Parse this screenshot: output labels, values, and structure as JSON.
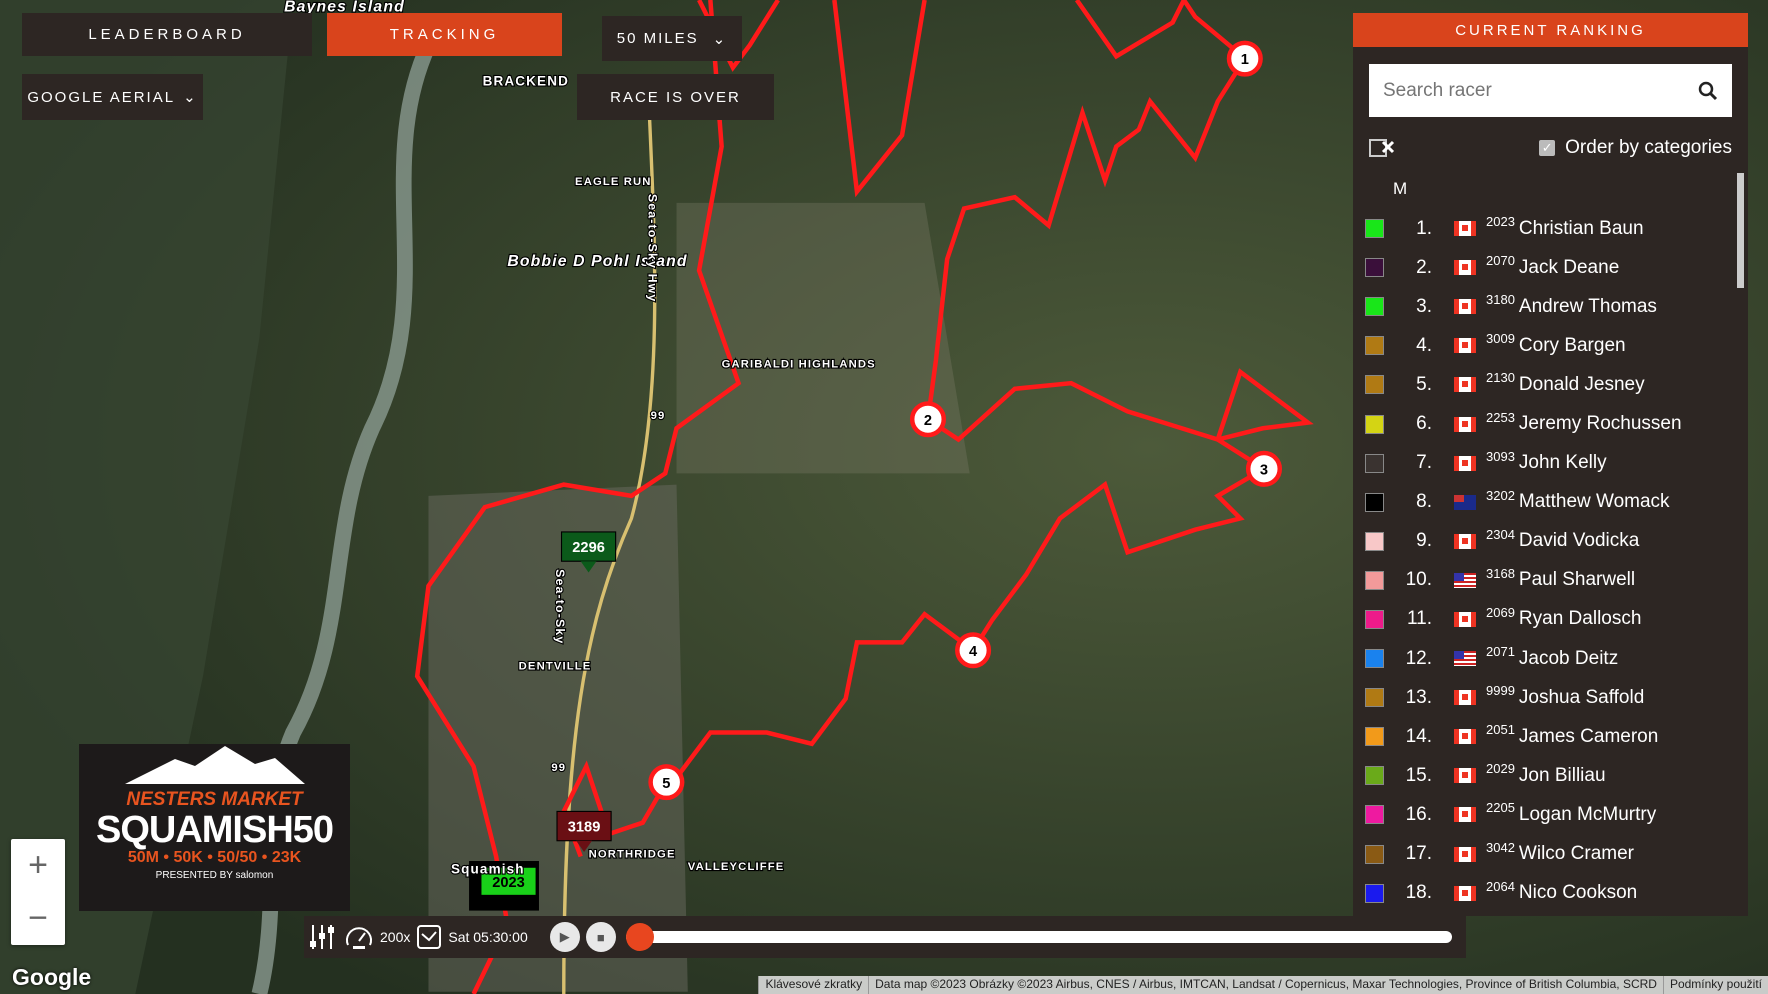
{
  "tabs": {
    "leaderboard": "LEADERBOARD",
    "tracking": "TRACKING"
  },
  "distance_select": "50 MILES",
  "layer_select": "GOOGLE AERIAL",
  "race_status": "RACE IS OVER",
  "colors": {
    "accent": "#d9441c",
    "panel": "#2d2623",
    "route": "#ff1a1a"
  },
  "map": {
    "labels": [
      "Baynes Island",
      "BRACKEND",
      "EAGLE RUN",
      "Bobbie D Pohl Island",
      "Sea-to-Sky Hwy",
      "GARIBALDI HIGHLANDS",
      "DENTVILLE",
      "NORTHRIDGE",
      "VALLEYCLIFFE",
      "Sea-to-Sky",
      "99",
      "99",
      "Squamish"
    ],
    "checkpoints": [
      "1",
      "2",
      "3",
      "4",
      "5"
    ],
    "racer_markers": [
      {
        "bib": "2296",
        "color": "#0b5a1a"
      },
      {
        "bib": "3189",
        "color": "#6a0f14"
      },
      {
        "bib": "2023",
        "color": "#19d119"
      }
    ]
  },
  "ranking": {
    "title": "CURRENT RANKING",
    "search_placeholder": "Search racer",
    "order_label": "Order by categories",
    "order_checked": true,
    "category": "M",
    "racers": [
      {
        "pos": "1.",
        "bib": "2023",
        "name": "Christian Baun",
        "flag": "CA",
        "color": "#19e619"
      },
      {
        "pos": "2.",
        "bib": "2070",
        "name": "Jack Deane",
        "flag": "CA",
        "color": "#3a0f3a"
      },
      {
        "pos": "3.",
        "bib": "3180",
        "name": "Andrew Thomas",
        "flag": "CA",
        "color": "#19e619"
      },
      {
        "pos": "4.",
        "bib": "3009",
        "name": "Cory Bargen",
        "flag": "CA",
        "color": "#b07a14"
      },
      {
        "pos": "5.",
        "bib": "2130",
        "name": "Donald Jesney",
        "flag": "CA",
        "color": "#b07a14"
      },
      {
        "pos": "6.",
        "bib": "2253",
        "name": "Jeremy Rochussen",
        "flag": "CA",
        "color": "#d4d414"
      },
      {
        "pos": "7.",
        "bib": "3093",
        "name": "John Kelly",
        "flag": "CA",
        "color": "#3a3330"
      },
      {
        "pos": "8.",
        "bib": "3202",
        "name": "Matthew Womack",
        "flag": "AU",
        "color": "#000000"
      },
      {
        "pos": "9.",
        "bib": "2304",
        "name": "David Vodicka",
        "flag": "CA",
        "color": "#f8c8c8"
      },
      {
        "pos": "10.",
        "bib": "3168",
        "name": "Paul Sharwell",
        "flag": "US",
        "color": "#f29a9a"
      },
      {
        "pos": "11.",
        "bib": "2069",
        "name": "Ryan Dallosch",
        "flag": "CA",
        "color": "#ee1a8a"
      },
      {
        "pos": "12.",
        "bib": "2071",
        "name": "Jacob Deitz",
        "flag": "US",
        "color": "#1a82ee"
      },
      {
        "pos": "13.",
        "bib": "9999",
        "name": "Joshua Saffold",
        "flag": "CA",
        "color": "#b07a14"
      },
      {
        "pos": "14.",
        "bib": "2051",
        "name": "James Cameron",
        "flag": "CA",
        "color": "#f29a1a"
      },
      {
        "pos": "15.",
        "bib": "2029",
        "name": "Jon Billiau",
        "flag": "CA",
        "color": "#6aaa1a"
      },
      {
        "pos": "16.",
        "bib": "2205",
        "name": "Logan McMurtry",
        "flag": "CA",
        "color": "#ee1aa0"
      },
      {
        "pos": "17.",
        "bib": "3042",
        "name": "Wilco Cramer",
        "flag": "CA",
        "color": "#8a5a14"
      },
      {
        "pos": "18.",
        "bib": "2064",
        "name": "Nico Cookson",
        "flag": "CA",
        "color": "#1a1aee"
      }
    ]
  },
  "logo": {
    "line1": "NESTERS MARKET",
    "line2": "SQUAMISH50",
    "line3": "50M • 50K • 50/50 • 23K",
    "line4": "PRESENTED BY salomon"
  },
  "playback": {
    "speed": "200x",
    "time": "Sat 05:30:00",
    "progress": 0
  },
  "zoom": {
    "in": "+",
    "out": "−"
  },
  "attribution": [
    "Klávesové zkratky",
    "Data map ©2023 Obrázky ©2023 Airbus, CNES / Airbus, IMTCAN, Landsat / Copernicus, Maxar Technologies, Province of British Columbia, SCRD",
    "Podmínky použití"
  ],
  "google": "Google"
}
